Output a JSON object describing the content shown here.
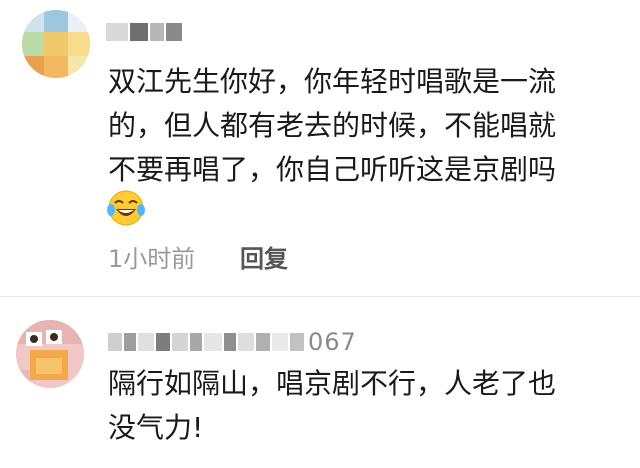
{
  "comments": [
    {
      "body_lines": [
        "双江先生你好，你年轻时唱歌是一流",
        "的，但人都有老去的时候，不能唱就",
        "不要再唱了，你自己听听这是京剧吗"
      ],
      "emoji": "laughing-tears-emoji",
      "time": "1小时前",
      "reply_label": "回复"
    },
    {
      "username_suffix": "067",
      "body_lines": [
        "隔行如隔山，唱京剧不行，人老了也",
        "没气力!"
      ]
    }
  ],
  "colors": {
    "text": "#1a1a1a",
    "meta": "#9a9a9a",
    "reply": "#555555"
  }
}
